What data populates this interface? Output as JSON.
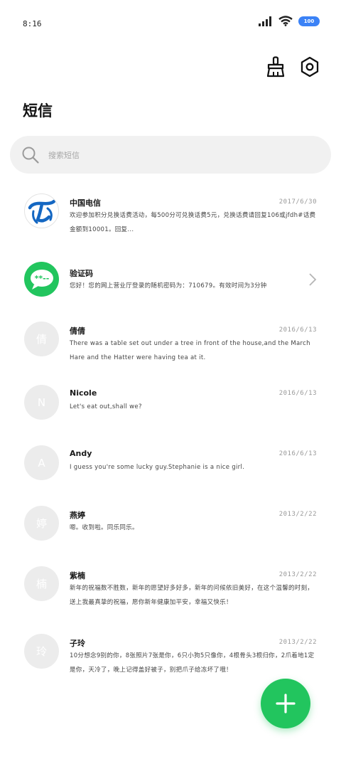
{
  "status": {
    "time": "8:16",
    "battery": "100"
  },
  "header": {
    "title": "短信",
    "clean_icon": "broom-icon",
    "settings_icon": "gear-icon"
  },
  "search": {
    "placeholder": "搜索短信"
  },
  "colors": {
    "accent": "#22c55e",
    "battery": "#3b82f6"
  },
  "conversations": [
    {
      "name": "中国电信",
      "date": "2017/6/30",
      "message": "欢迎参加积分兑换话费活动，每500分可兑换话费5元，兑换话费请回复106或jfdh#话费金额到10001。回复...",
      "avatar": "china-telecom-logo"
    },
    {
      "name": "验证码",
      "date": "",
      "message": "您好！您的网上营业厅登录的随机密码为：710679。有效时间为3分钟",
      "avatar": "sms-code-logo"
    },
    {
      "name": "倩倩",
      "date": "2016/6/13",
      "message": "There was a table set out under a tree in front of the house,and the March Hare and the Hatter were having tea at it.",
      "initial": "倩"
    },
    {
      "name": "Nicole",
      "date": "2016/6/13",
      "message": "Let's eat out,shall we?",
      "initial": "N"
    },
    {
      "name": "Andy",
      "date": "2016/6/13",
      "message": "I guess you're some lucky guy.Stephanie is a nice girl.",
      "initial": "A"
    },
    {
      "name": "燕婷",
      "date": "2013/2/22",
      "message": "嗯。收到啦。同乐同乐。",
      "initial": "婷"
    },
    {
      "name": "紫楠",
      "date": "2013/2/22",
      "message": "新年的祝福数不胜数，新年的愿望好多好多，新年的问候依旧美好，在这个温馨的时刻，送上我最真挚的祝福，愿你新年健康加平安，幸福又快乐！",
      "initial": "楠"
    },
    {
      "name": "子玲",
      "date": "2013/2/22",
      "message": "10分想念9别的你，8张照片7张是你，6只小狗5只像你，4根骨头3根归你，2爪着地1定是你，天冷了，晚上记得盖好被子，别把爪子给冻坏了哦！",
      "initial": "玲"
    }
  ],
  "fab": {
    "icon": "plus-icon"
  }
}
